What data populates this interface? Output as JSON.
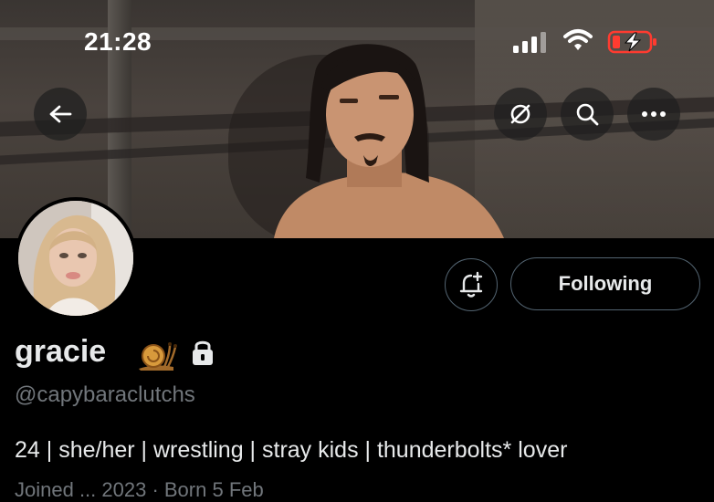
{
  "status_bar": {
    "time": "21:28",
    "signal_icon": "signal-bars-icon",
    "wifi_icon": "wifi-icon",
    "battery_icon": "battery-charging-icon",
    "battery_color": "#ff3b30"
  },
  "header": {
    "back_icon": "arrow-left-icon",
    "actions": [
      "no-filter-icon",
      "search-icon",
      "more-icon"
    ]
  },
  "profile": {
    "display_name": "gracie",
    "name_emoji": "snail-emoji",
    "protected_icon": "lock-icon",
    "handle": "@capybaraclutchs",
    "bio": "24 | she/her | wrestling | stray kids | thunderbolts* lover",
    "meta_partial": "Joined ... 2023  ·  Born 5 Feb",
    "follow_label": "Following",
    "notify_icon": "bell-plus-icon"
  },
  "colors": {
    "background": "#000000",
    "text": "#e7e9ea",
    "secondary": "#71767b",
    "border": "#536471"
  }
}
